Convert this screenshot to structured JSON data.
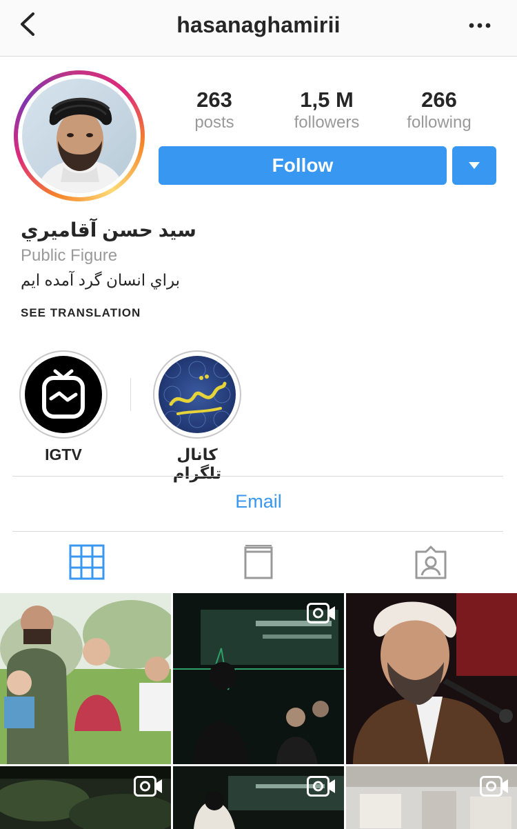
{
  "nav": {
    "username": "hasanaghamirii",
    "back_icon": "chevron-left-icon",
    "more_icon": "more-dots-icon"
  },
  "profile": {
    "stats": [
      {
        "value": "263",
        "label": "posts"
      },
      {
        "value": "1,5 M",
        "label": "followers"
      },
      {
        "value": "266",
        "label": "following"
      }
    ],
    "follow_label": "Follow",
    "name": "سيد حسن آقاميري",
    "category": "Public Figure",
    "bio": "براي انسان گرد آمده ايم",
    "see_translation": "SEE TRANSLATION"
  },
  "highlights": [
    {
      "label": "IGTV",
      "icon": "igtv-icon"
    },
    {
      "label": "كانال تلگرام"
    }
  ],
  "contact": {
    "email_label": "Email"
  },
  "tabs": [
    {
      "name": "grid",
      "icon": "grid-icon",
      "active": true
    },
    {
      "name": "igtv",
      "icon": "book-icon",
      "active": false
    },
    {
      "name": "tagged",
      "icon": "tagged-person-icon",
      "active": false
    }
  ],
  "colors": {
    "accent": "#3897f0",
    "muted": "#999999",
    "divider": "#dbdbdb",
    "text": "#262626"
  }
}
